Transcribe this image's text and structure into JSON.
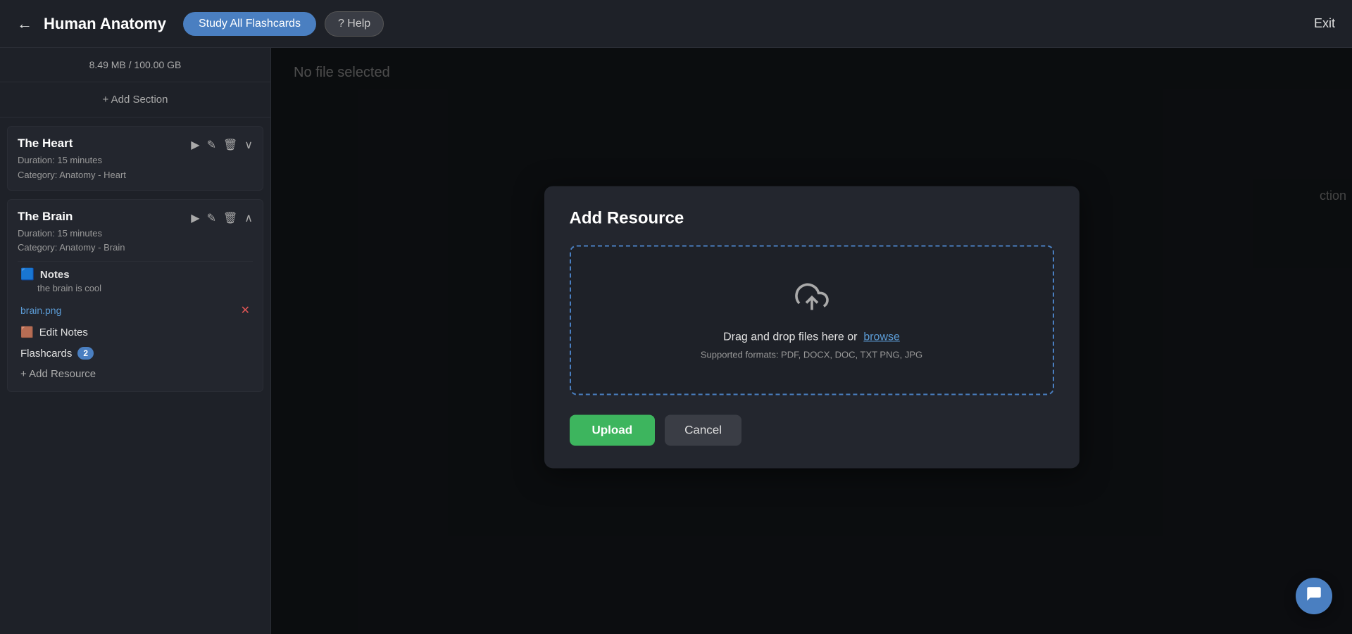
{
  "header": {
    "back_icon": "←",
    "title": "Human Anatomy",
    "study_button": "Study All Flashcards",
    "help_button": "? Help",
    "exit_button": "Exit"
  },
  "sidebar": {
    "storage": "8.49 MB / 100.00 GB",
    "add_section": "+ Add Section",
    "sections": [
      {
        "name": "The Heart",
        "duration": "Duration: 15 minutes",
        "category": "Category: Anatomy - Heart",
        "expanded": false
      },
      {
        "name": "The Brain",
        "duration": "Duration: 15 minutes",
        "category": "Category: Anatomy - Brain",
        "expanded": true
      }
    ],
    "brain_items": {
      "notes_label": "Notes",
      "notes_icon": "🟦",
      "notes_content": "the brain is cool",
      "file_name": "brain.png",
      "edit_notes_icon": "🟫",
      "edit_notes_label": "Edit Notes",
      "flashcards_label": "Flashcards",
      "flashcards_count": "2",
      "add_resource_label": "+ Add Resource"
    }
  },
  "main": {
    "no_file_text": "No file selected",
    "partial_label": "ction"
  },
  "modal": {
    "title": "Add Resource",
    "drop_text": "Drag and drop files here or",
    "browse_text": "browse",
    "formats_text": "Supported formats: PDF, DOCX, DOC, TXT PNG, JPG",
    "upload_button": "Upload",
    "cancel_button": "Cancel"
  },
  "icons": {
    "upload": "⬆",
    "chat": "💬"
  }
}
